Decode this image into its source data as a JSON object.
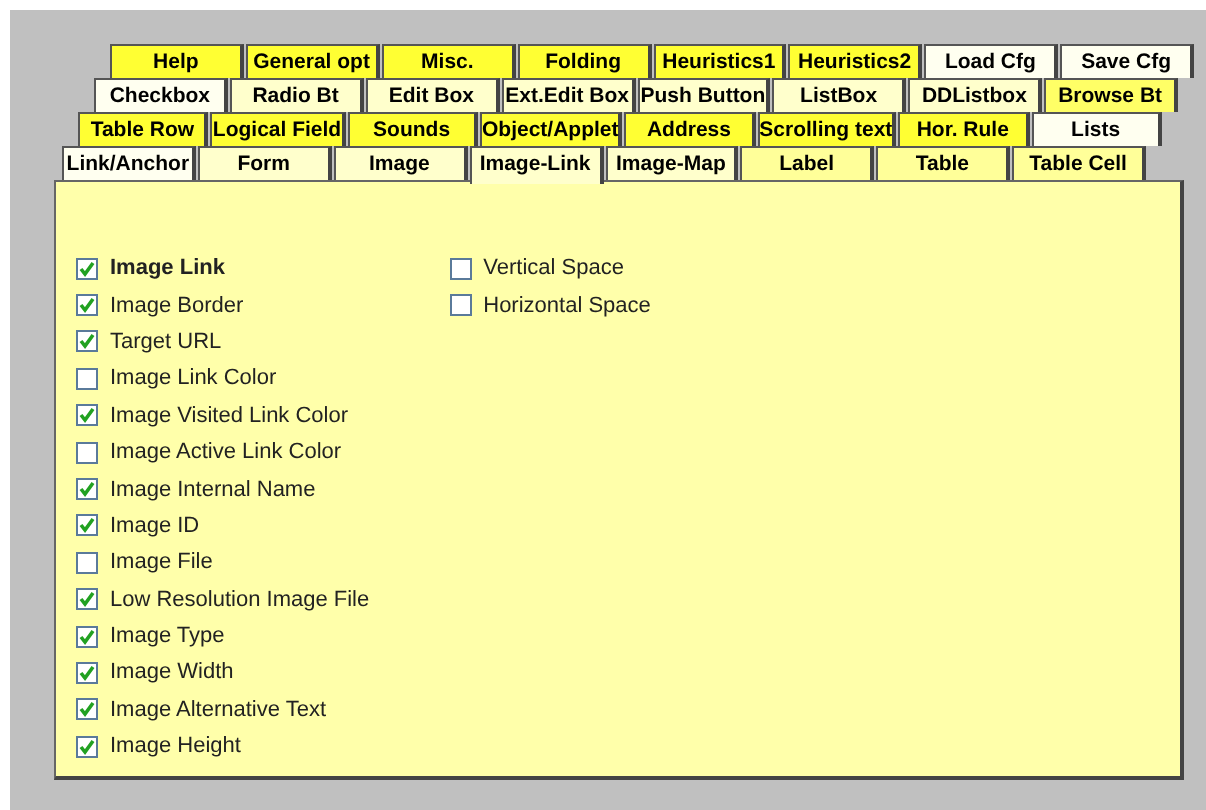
{
  "tab_rows": [
    {
      "tabs": [
        {
          "label": "Help",
          "selected": false,
          "color": "#ffff33"
        },
        {
          "label": "General opt",
          "selected": false,
          "color": "#ffff33"
        },
        {
          "label": "Misc.",
          "selected": false,
          "color": "#ffff33"
        },
        {
          "label": "Folding",
          "selected": false,
          "color": "#ffff33"
        },
        {
          "label": "Heuristics1",
          "selected": false,
          "color": "#ffff33"
        },
        {
          "label": "Heuristics2",
          "selected": false,
          "color": "#ffff33"
        },
        {
          "label": "Load Cfg",
          "selected": false,
          "color": "#fffff0"
        },
        {
          "label": "Save Cfg",
          "selected": false,
          "color": "#fffff0"
        }
      ]
    },
    {
      "tabs": [
        {
          "label": "Checkbox",
          "selected": false,
          "color": "#fffff0"
        },
        {
          "label": "Radio Bt",
          "selected": false,
          "color": "#ffffcc"
        },
        {
          "label": "Edit Box",
          "selected": false,
          "color": "#ffffcc"
        },
        {
          "label": "Ext.Edit Box",
          "selected": false,
          "color": "#ffffcc"
        },
        {
          "label": "Push Button",
          "selected": false,
          "color": "#ffffcc"
        },
        {
          "label": "ListBox",
          "selected": false,
          "color": "#ffffcc"
        },
        {
          "label": "DDListbox",
          "selected": false,
          "color": "#ffffcc"
        },
        {
          "label": "Browse Bt",
          "selected": false,
          "color": "#ffff66"
        }
      ]
    },
    {
      "tabs": [
        {
          "label": "Table Row",
          "selected": false,
          "color": "#ffff33"
        },
        {
          "label": "Logical Field",
          "selected": false,
          "color": "#ffff33"
        },
        {
          "label": "Sounds",
          "selected": false,
          "color": "#ffff33"
        },
        {
          "label": "Object/Applet",
          "selected": false,
          "color": "#ffff33"
        },
        {
          "label": "Address",
          "selected": false,
          "color": "#ffff33"
        },
        {
          "label": "Scrolling text",
          "selected": false,
          "color": "#ffff33"
        },
        {
          "label": "Hor. Rule",
          "selected": false,
          "color": "#ffff33"
        },
        {
          "label": "Lists",
          "selected": false,
          "color": "#fffff0"
        }
      ]
    },
    {
      "tabs": [
        {
          "label": "Link/Anchor",
          "selected": false,
          "color": "#fffff0"
        },
        {
          "label": "Form",
          "selected": false,
          "color": "#ffffcc"
        },
        {
          "label": "Image",
          "selected": false,
          "color": "#ffffcc"
        },
        {
          "label": "Image-Link",
          "selected": true,
          "color": "#ffffcc"
        },
        {
          "label": "Image-Map",
          "selected": false,
          "color": "#ffffcc"
        },
        {
          "label": "Label",
          "selected": false,
          "color": "#ffff99"
        },
        {
          "label": "Table",
          "selected": false,
          "color": "#ffff99"
        },
        {
          "label": "Table Cell",
          "selected": false,
          "color": "#ffff99"
        }
      ]
    }
  ],
  "columns": [
    {
      "options": [
        {
          "label": "Image Link",
          "checked": true,
          "emphasized": true
        },
        {
          "label": "Image Border",
          "checked": true,
          "emphasized": false
        },
        {
          "label": "Target URL",
          "checked": true,
          "emphasized": false
        },
        {
          "label": "Image Link Color",
          "checked": false,
          "emphasized": false
        },
        {
          "label": "Image Visited Link Color",
          "checked": true,
          "emphasized": false
        },
        {
          "label": "Image Active Link Color",
          "checked": false,
          "emphasized": false
        },
        {
          "label": "Image Internal Name",
          "checked": true,
          "emphasized": false
        },
        {
          "label": "Image ID",
          "checked": true,
          "emphasized": false
        },
        {
          "label": "Image File",
          "checked": false,
          "emphasized": false
        },
        {
          "label": "Low Resolution Image File",
          "checked": true,
          "emphasized": false
        },
        {
          "label": "Image Type",
          "checked": true,
          "emphasized": false
        },
        {
          "label": "Image Width",
          "checked": true,
          "emphasized": false
        },
        {
          "label": "Image Alternative Text",
          "checked": true,
          "emphasized": false
        },
        {
          "label": "Image Height",
          "checked": true,
          "emphasized": false
        }
      ]
    },
    {
      "options": [
        {
          "label": "Vertical Space",
          "checked": false,
          "emphasized": false
        },
        {
          "label": "Horizontal Space",
          "checked": false,
          "emphasized": false
        }
      ]
    }
  ]
}
